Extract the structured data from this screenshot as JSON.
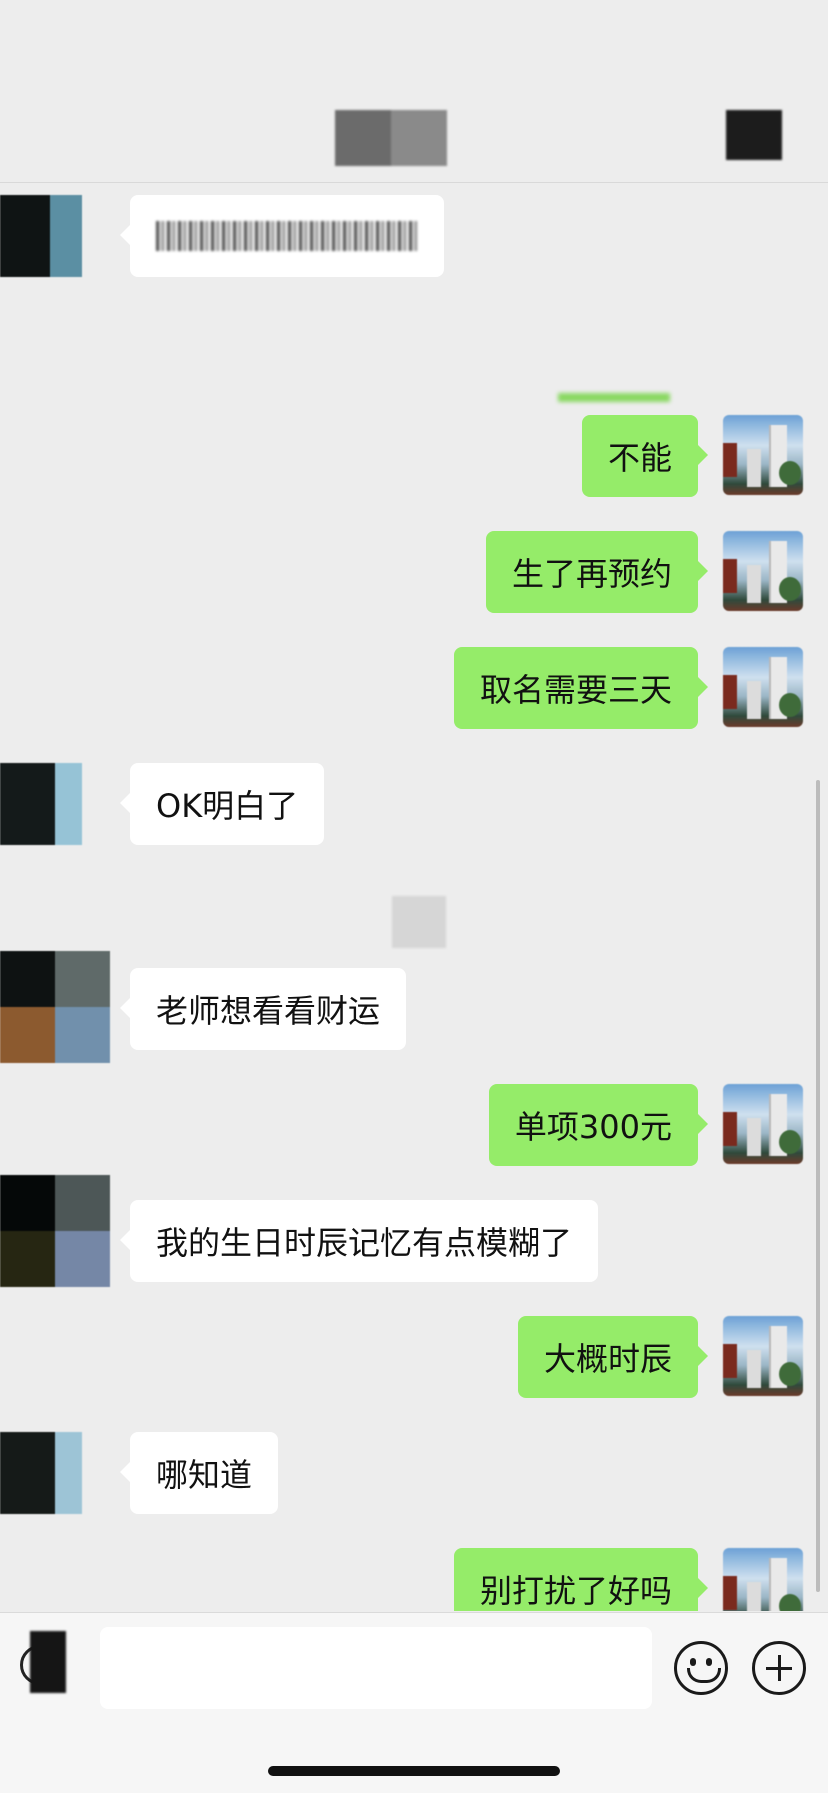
{
  "header": {
    "title_redacted": true
  },
  "messages": [
    {
      "dir": "in",
      "text": "",
      "redacted": true
    },
    {
      "dir": "out",
      "text": "不能"
    },
    {
      "dir": "out",
      "text": "生了再预约"
    },
    {
      "dir": "out",
      "text": "取名需要三天"
    },
    {
      "dir": "in",
      "text": "OK明白了"
    },
    {
      "dir": "in",
      "text": "老师想看看财运"
    },
    {
      "dir": "out",
      "text": "单项300元"
    },
    {
      "dir": "in",
      "text": "我的生日时辰记忆有点模糊了"
    },
    {
      "dir": "out",
      "text": "大概时辰"
    },
    {
      "dir": "in",
      "text": "哪知道"
    },
    {
      "dir": "out",
      "text": "别打扰了好吗"
    }
  ],
  "input_bar": {
    "placeholder": "",
    "icons": [
      "voice-icon",
      "emoji-icon",
      "plus-icon"
    ]
  },
  "colors": {
    "background": "#ededed",
    "incoming_bubble": "#ffffff",
    "outgoing_bubble": "#95ec69",
    "input_bar": "#f6f6f6"
  }
}
